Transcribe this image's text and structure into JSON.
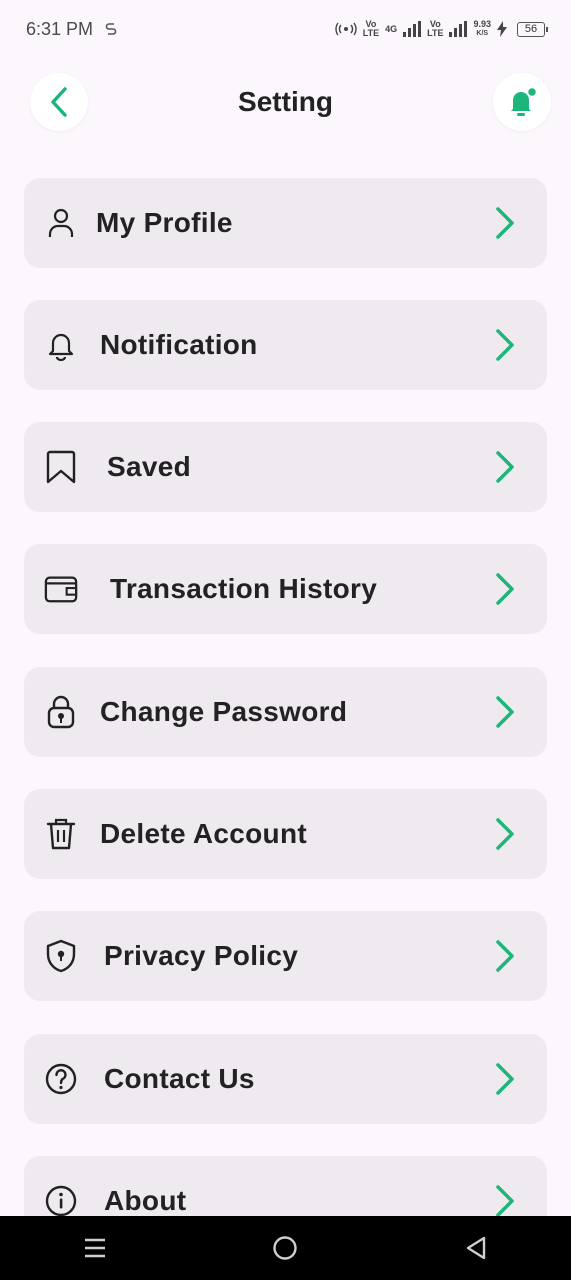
{
  "status": {
    "time": "6:31 PM",
    "speed_value": "9.93",
    "speed_unit": "K/S",
    "battery": "56",
    "net1_top": "Vo",
    "net1_bottom": "LTE",
    "net2_top": "4G",
    "net3_top": "Vo",
    "net3_bottom": "LTE"
  },
  "header": {
    "title": "Setting",
    "back_icon": "chevron-left-icon",
    "notification_icon": "bell-icon"
  },
  "colors": {
    "accent": "#1db57a",
    "card": "#efeaf0",
    "background": "#fcf7fc"
  },
  "menu": {
    "items": [
      {
        "label": "My Profile",
        "icon": "user-icon"
      },
      {
        "label": "Notification",
        "icon": "bell-outline-icon"
      },
      {
        "label": "Saved",
        "icon": "bookmark-icon"
      },
      {
        "label": "Transaction History",
        "icon": "wallet-icon"
      },
      {
        "label": "Change Password",
        "icon": "lock-icon"
      },
      {
        "label": "Delete Account",
        "icon": "trash-icon"
      },
      {
        "label": "Privacy Policy",
        "icon": "shield-icon"
      },
      {
        "label": "Contact Us",
        "icon": "question-icon"
      },
      {
        "label": "About",
        "icon": "info-icon"
      }
    ]
  },
  "navbar": {
    "items": [
      "menu-icon",
      "home-icon",
      "back-triangle-icon"
    ]
  }
}
